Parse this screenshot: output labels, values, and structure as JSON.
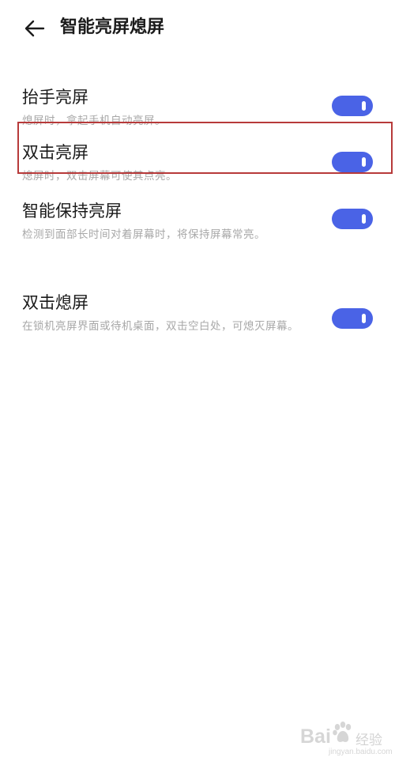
{
  "header": {
    "title": "智能亮屏熄屏"
  },
  "settings": [
    {
      "title": "抬手亮屏",
      "description": "熄屏时，拿起手机自动亮屏。",
      "enabled": true
    },
    {
      "title": "双击亮屏",
      "description": "熄屏时，双击屏幕可使其点亮。",
      "enabled": true
    },
    {
      "title": "智能保持亮屏",
      "description": "检测到面部长时间对着屏幕时，将保持屏幕常亮。",
      "enabled": true
    },
    {
      "title": "双击熄屏",
      "description": "在锁机亮屏界面或待机桌面，双击空白处，可熄灭屏幕。",
      "enabled": true
    }
  ],
  "watermark": {
    "brand": "Bai",
    "brand_suffix": "经验",
    "url": "jingyan.baidu.com"
  },
  "colors": {
    "toggle_on": "#4a63e6",
    "highlight_border": "#b73a3a"
  },
  "icons": {
    "back": "arrow-left-icon"
  }
}
